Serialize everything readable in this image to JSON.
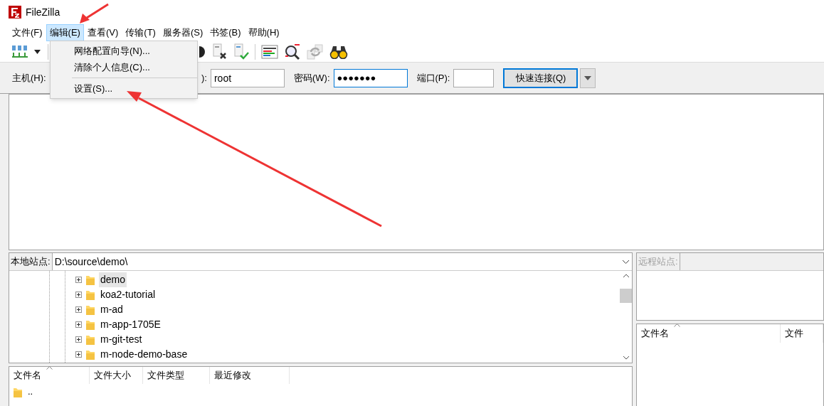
{
  "window": {
    "title": "FileZilla"
  },
  "menu_bar": [
    {
      "label": "文件(F)",
      "selected": false
    },
    {
      "label": "编辑(E)",
      "selected": true
    },
    {
      "label": "查看(V)",
      "selected": false
    },
    {
      "label": "传输(T)",
      "selected": false
    },
    {
      "label": "服务器(S)",
      "selected": false
    },
    {
      "label": "书签(B)",
      "selected": false
    },
    {
      "label": "帮助(H)",
      "selected": false
    }
  ],
  "open_menu": {
    "items": [
      {
        "kind": "command",
        "label": "网络配置向导(N)..."
      },
      {
        "kind": "command",
        "label": "清除个人信息(C)..."
      },
      {
        "kind": "separator"
      },
      {
        "kind": "command",
        "label": "设置(S)..."
      }
    ]
  },
  "quickconnect": {
    "host_label": "主机(H):",
    "user_label": "):",
    "user_value": "root",
    "password_label": "密码(W):",
    "password_value": "●●●●●●●",
    "port_label": "端口(P):",
    "connect_button": "快速连接(Q)"
  },
  "local": {
    "site_label": "本地站点:",
    "path": "D:\\source\\demo\\",
    "tree": [
      {
        "label": "demo",
        "selected": true,
        "expanded": false
      },
      {
        "label": "koa2-tutorial",
        "selected": false,
        "expanded": false
      },
      {
        "label": "m-ad",
        "selected": false,
        "expanded": false
      },
      {
        "label": "m-app-1705E",
        "selected": false,
        "expanded": false
      },
      {
        "label": "m-git-test",
        "selected": false,
        "expanded": false
      },
      {
        "label": "m-node-demo-base",
        "selected": false,
        "expanded": false
      }
    ],
    "columns": [
      {
        "label": "文件名",
        "sorted": true
      },
      {
        "label": "文件大小",
        "sorted": false
      },
      {
        "label": "文件类型",
        "sorted": false
      },
      {
        "label": "最近修改",
        "sorted": false
      }
    ],
    "rows": [
      {
        "name": ".."
      }
    ]
  },
  "remote": {
    "site_label": "远程站点:",
    "disabled": true,
    "columns": [
      {
        "label": "文件名",
        "sorted": true
      },
      {
        "label": "文件",
        "sorted": false
      }
    ]
  }
}
